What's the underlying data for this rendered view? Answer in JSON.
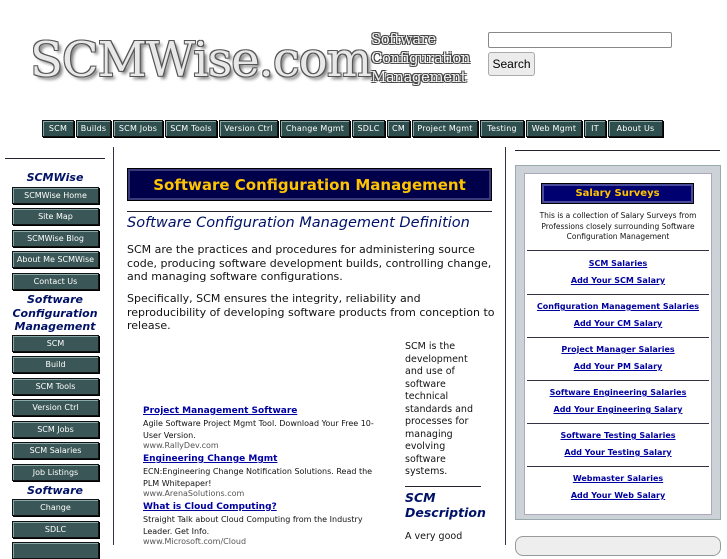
{
  "header": {
    "logo_text": "SCMWise.com",
    "tagline": [
      "Software",
      "Configuration",
      "Management"
    ],
    "search": {
      "value": "",
      "button_label": "Search"
    }
  },
  "topnav": [
    "SCM",
    "Builds",
    "SCM Jobs",
    "SCM Tools",
    "Version Ctrl",
    "Change Mgmt",
    "SDLC",
    "CM",
    "Project Mgmt",
    "Testing",
    "Web Mgmt",
    "IT",
    "About Us"
  ],
  "sidebar": {
    "sections": [
      {
        "heading": "SCMWise",
        "items": [
          "SCMWise Home",
          "Site Map",
          "SCMWise Blog",
          "About Me SCMWise",
          "Contact Us"
        ]
      },
      {
        "heading": "Software Configuration Management",
        "items": [
          "SCM",
          "Build",
          "SCM Tools",
          "Version Ctrl",
          "SCM Jobs",
          "SCM Salaries",
          "Job Listings"
        ]
      },
      {
        "heading": "Software",
        "items": [
          "Change",
          "SDLC"
        ]
      }
    ]
  },
  "main": {
    "banner": "Software Configuration Management",
    "definition_title": "Software Configuration Management Definition",
    "paragraphs": [
      "SCM are the practices and procedures for administering source code, producing software development builds, controlling change, and managing software configurations.",
      "Specifically, SCM ensures the integrity, reliability and reproducibility of developing software products from conception to release."
    ],
    "ads": [
      {
        "title": "Project Management Software",
        "text": "Agile Software Project Mgmt Tool. Download Your Free 10-User Version.",
        "url": "www.RallyDev.com"
      },
      {
        "title": "Engineering Change Mgmt",
        "text": "ECN:Engineering Change Notification Solutions. Read the PLM Whitepaper!",
        "url": "www.ArenaSolutions.com"
      },
      {
        "title": "What is Cloud Computing?",
        "text": "Straight Talk about Cloud Computing from the Industry Leader. Get Info.",
        "url": "www.Microsoft.com/Cloud"
      }
    ],
    "scm_blurb": "SCM is the development and use of software technical standards and processes for managing evolving software systems.",
    "description_title": "SCM Description",
    "description_text": "A very good"
  },
  "salary": {
    "banner": "Salary Surveys",
    "intro": "This is a collection of Salary Surveys from Professions closely surrounding Software Configuration Management",
    "groups": [
      {
        "survey": "SCM Salaries",
        "add": "Add Your SCM Salary"
      },
      {
        "survey": "Configuration Management Salaries",
        "add": "Add Your CM Salary"
      },
      {
        "survey": "Project Manager Salaries",
        "add": "Add Your PM Salary"
      },
      {
        "survey": "Software Engineering Salaries",
        "add": "Add Your Engineering Salary"
      },
      {
        "survey": "Software Testing Salaries",
        "add": "Add Your Testing Salary"
      },
      {
        "survey": "Webmaster Salaries",
        "add": "Add Your Web Salary"
      }
    ]
  },
  "colors": {
    "accent_navy": "#00004a",
    "accent_gold": "#ffc400",
    "button_teal": "#2f4f4f",
    "link_blue": "#0000a0"
  }
}
